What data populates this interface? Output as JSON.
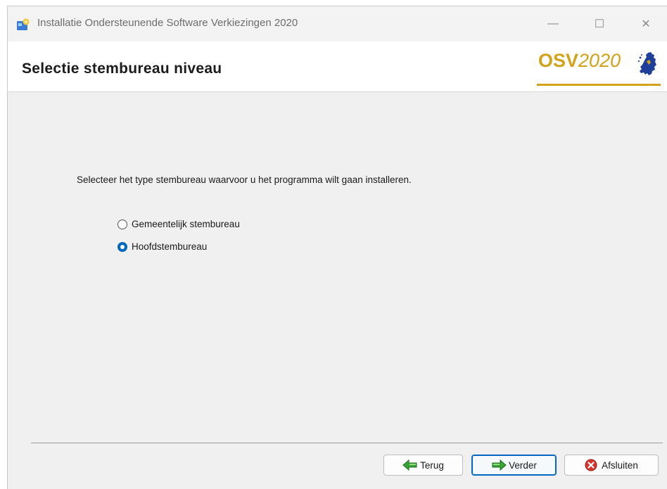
{
  "window": {
    "title": "Installatie Ondersteunende Software Verkiezingen 2020",
    "controls": {
      "minimize": "—",
      "maximize": "☐",
      "close": "✕"
    }
  },
  "header": {
    "title": "Selectie stembureau niveau",
    "logo": {
      "bold": "OSV",
      "italic": "2020",
      "color": "#d4a21a"
    }
  },
  "main": {
    "instruction": "Selecteer het type stembureau waarvoor u het programma wilt gaan installeren.",
    "options": [
      {
        "label": "Gemeentelijk stembureau",
        "selected": false
      },
      {
        "label": "Hoofdstembureau",
        "selected": true
      }
    ]
  },
  "buttons": {
    "back": {
      "label": "Terug",
      "icon": "arrow-left-icon"
    },
    "next": {
      "label": "Verder",
      "icon": "arrow-right-icon"
    },
    "close": {
      "label": "Afsluiten",
      "icon": "close-circle-icon"
    }
  },
  "colors": {
    "accent": "#0067c0",
    "brand": "#d4a21a",
    "arrow_green": "#3aa335",
    "close_red": "#d9342b"
  }
}
